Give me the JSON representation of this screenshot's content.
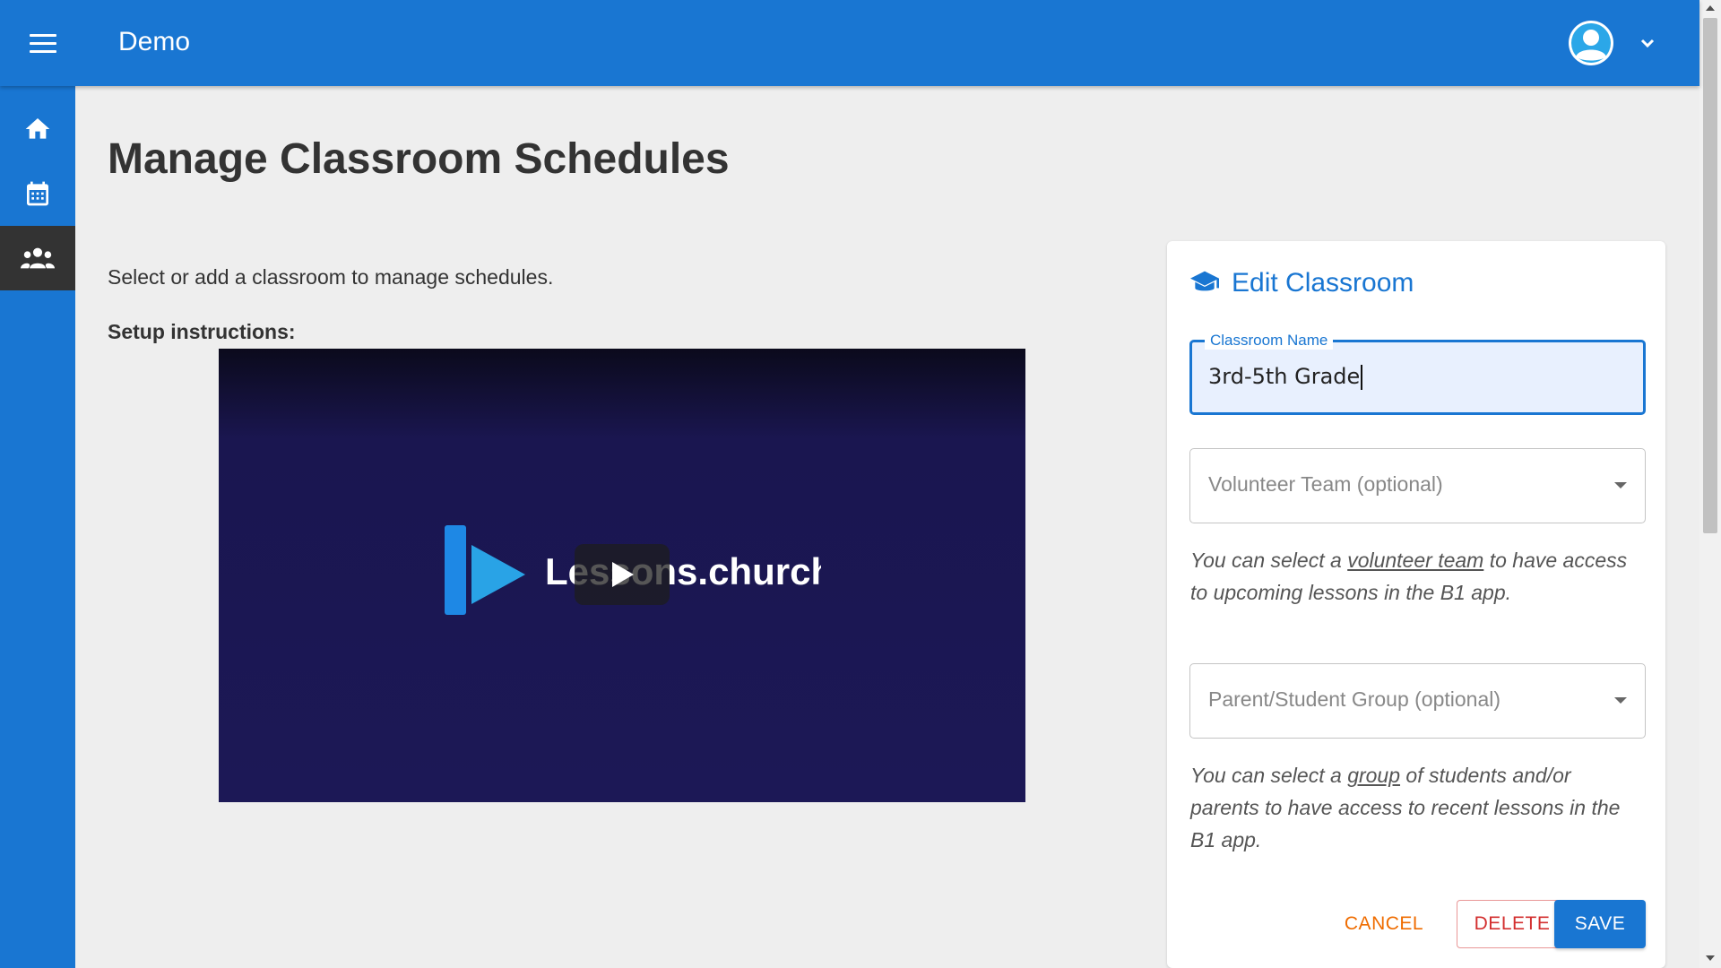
{
  "header": {
    "app_title": "Demo",
    "menu_icon": "hamburger-menu-icon",
    "avatar_icon": "user-avatar-icon",
    "account_menu_icon": "chevron-down-icon"
  },
  "sidebar": {
    "items": [
      {
        "icon": "home-icon",
        "name": "Home",
        "active": false
      },
      {
        "icon": "calendar-icon",
        "name": "Schedules",
        "active": false
      },
      {
        "icon": "people-icon",
        "name": "Classrooms",
        "active": true
      }
    ]
  },
  "main": {
    "title": "Manage Classroom Schedules",
    "intro": "Select or add a classroom to manage schedules.",
    "setup_label": "Setup instructions:",
    "video": {
      "brand": "Lessons.church",
      "play_icon": "play-icon"
    }
  },
  "edit_card": {
    "icon": "graduation-cap-icon",
    "title": "Edit Classroom",
    "classroom_name_label": "Classroom Name",
    "classroom_name_value": "3rd-5th Grade",
    "volunteer_team_placeholder": "Volunteer Team (optional)",
    "volunteer_help_prefix": "You can select a ",
    "volunteer_help_link": "volunteer team",
    "volunteer_help_suffix": " to have access to upcoming lessons in the B1 app.",
    "group_placeholder": "Parent/Student Group (optional)",
    "group_help_prefix": "You can select a ",
    "group_help_link": "group",
    "group_help_suffix": " of students and/or parents to have access to recent lessons in the B1 app.",
    "cancel_label": "CANCEL",
    "delete_label": "DELETE",
    "save_label": "SAVE"
  },
  "colors": {
    "primary": "#1976d2",
    "sidebar_active": "#333333",
    "cancel": "#ef6c00",
    "delete": "#d32f2f",
    "video_bg": "#1c1856"
  }
}
